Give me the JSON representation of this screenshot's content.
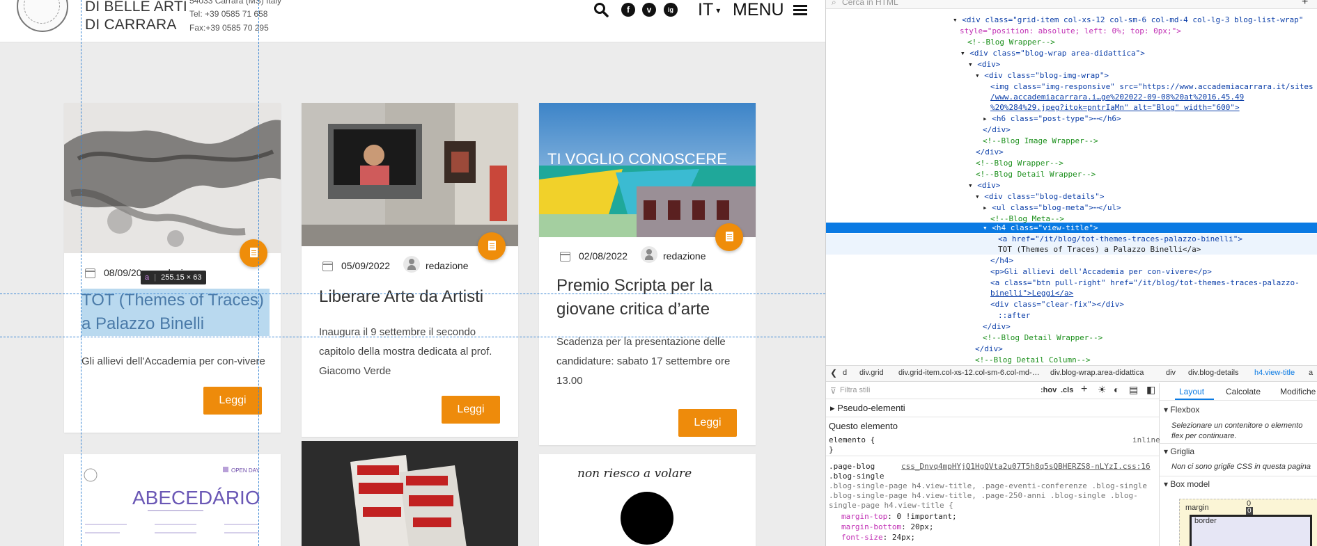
{
  "header": {
    "brand_line1": "DI BELLE ARTI",
    "brand_line2_prefix": "DI ",
    "brand_line2_strong": "CARRARA",
    "address": "54033 Carrara (MS) Italy",
    "tel": "Tel: +39 0585 71 658",
    "fax": "Fax:+39 0585 70 295",
    "lang": "IT",
    "menu": "MENU",
    "social": [
      "f",
      "v",
      "ig"
    ]
  },
  "cards": [
    {
      "date": "08/09/2022",
      "author": "redazione",
      "title": "TOT (Themes of Traces) a Palazzo Binelli",
      "excerpt": "Gli allievi dell'Accademia per con-vivere",
      "button": "Leggi"
    },
    {
      "date": "05/09/2022",
      "author": "redazione",
      "title": "Liberare Arte da Artisti",
      "excerpt": "Inaugura il 9 settembre il secondo capitolo della mostra dedicata al prof. Giacomo Verde",
      "button": "Leggi"
    },
    {
      "date": "02/08/2022",
      "author": "redazione",
      "title": "Premio Scripta per la giovane critica d’arte",
      "excerpt": "Scadenza per la presentazione delle candidature: sabato 17 settembre ore 13.00",
      "button": "Leggi"
    }
  ],
  "card1_meta_visible": "08/09/20",
  "card1_author_visible": "dazione",
  "image_text": {
    "card3_banner": "TI VOGLIO CONOSCERE",
    "bottom1_title": "ABECEDÁRIO",
    "bottom1_tag": "OPEN DAY",
    "bottom3_handwritten": "non riesco a volare"
  },
  "tooltip": {
    "tag": "a",
    "size": "255.15 × 63"
  },
  "colors": {
    "accent": "#ee8b0b",
    "selection": "#0a7ae3",
    "guide": "#3a86d4"
  },
  "devtools": {
    "search_placeholder": "Cerca in HTML",
    "html_lines": [
      "<div class=\"grid-item col-xs-12 col-sm-6 col-md-4 col-lg-3 blog-list-wrap\"",
      "style=\"position: absolute; left: 0%; top: 0px;\">",
      "<!--Blog Wrapper-->",
      "<div class=\"blog-wrap area-didattica\">",
      "<div>",
      "<div class=\"blog-img-wrap\">",
      "<img class=\"img-responsive\" src=\"https://www.accademiacarrara.it/sites",
      "/www.accademiacarrara.i…ge%202022-09-08%20at%2016.45.49",
      "%20%284%29.jpeg?itok=pntrIaMn\" alt=\"Blog\" width=\"600\">",
      "<h6 class=\"post-type\">⋯</h6>",
      "</div>",
      "<!--Blog Image Wrapper-->",
      "</div>",
      "<!--Blog Wrapper-->",
      "<!--Blog Detail Wrapper-->",
      "<div>",
      "<div class=\"blog-details\">",
      "<ul class=\"blog-meta\">⋯</ul>",
      "<!--Blog Meta-->",
      "<h4 class=\"view-title\">",
      "<a href=\"/it/blog/tot-themes-traces-palazzo-binelli\">",
      "TOT (Themes of Traces) a Palazzo Binelli</a>",
      "</h4>",
      "<p>Gli allievi dell'Accademia per con-vivere</p>",
      "<a class=\"btn pull-right\" href=\"/it/blog/tot-themes-traces-palazzo-",
      "binelli\">Leggi</a>",
      "<div class=\"clear-fix\"></div>",
      "::after",
      "</div>",
      "<!--Blog Detail Wrapper-->",
      "</div>",
      "<!--Blog Detail Column-->"
    ],
    "breadcrumb": [
      "d",
      "div.grid",
      "div.grid-item.col-xs-12.col-sm-6.col-md-…",
      "div.blog-wrap.area-didattica",
      "div",
      "div.blog-details",
      "h4.view-title",
      "a"
    ],
    "styles": {
      "filter_placeholder": "Filtra stili",
      "hov": ":hov",
      "cls": ".cls",
      "pseudo": "Pseudo-elementi",
      "this_element": "Questo elemento",
      "element_rule": "elemento {",
      "inline": "inline",
      "close_brace": "}",
      "selector1": ".page-blog",
      "selector1b": ".blog-single",
      "source": "css_Dnvq4mpHYjQ1HgQVta2u07T5h8q5sQBHERZS8-nLYzI.css:16",
      "selector_rest": ".blog-single-page h4.view-title, .page-eventi-conferenze .blog-single .blog-single-page h4.view-title, .page-250-anni .blog-single .blog-single-page h4.view-title {",
      "prop1": "margin-top",
      "val1": "0 !important;",
      "prop2": "margin-bottom",
      "val2": "20px;",
      "prop3": "font-size",
      "val3": "24px;"
    },
    "layout_tabs": [
      "Layout",
      "Calcolate",
      "Modifiche"
    ],
    "flexbox_title": "Flexbox",
    "flexbox_hint": "Selezionare un contenitore o elemento flex per continuare.",
    "grid_title": "Griglia",
    "grid_hint": "Non ci sono griglie CSS in questa pagina",
    "boxmodel_title": "Box model",
    "box_margin": "margin",
    "box_margin_val": "0",
    "box_border": "border",
    "box_border_val": "0"
  }
}
